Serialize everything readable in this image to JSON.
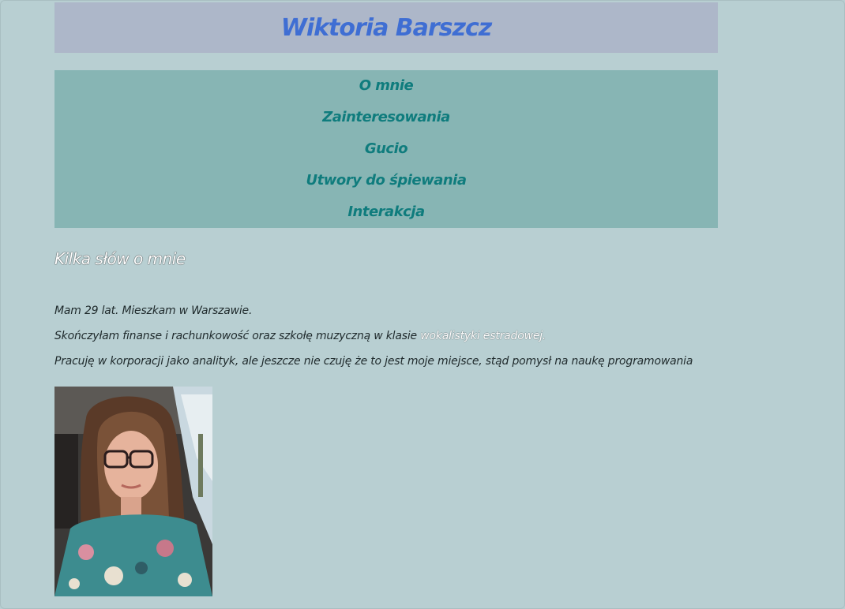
{
  "header": {
    "title": "Wiktoria Barszcz"
  },
  "nav": {
    "items": [
      {
        "label": "O mnie"
      },
      {
        "label": "Zainteresowania"
      },
      {
        "label": "Gucio"
      },
      {
        "label": "Utwory do śpiewania"
      },
      {
        "label": "Interakcja"
      }
    ]
  },
  "about": {
    "heading": "Kilka słów o mnie",
    "line1": "Mam 29 lat. Mieszkam w Warszawie.",
    "line2_start": "Skończyłam finanse i rachunkowość oraz szkołę muzyczną w klasie ",
    "line2_outlined": "wokalistyki estradowej.",
    "line3": "Pracuję w korporacji jako analityk, ale jeszcze nie czuję że to jest moje miejsce, stąd pomysł na naukę programowania"
  },
  "colors": {
    "background": "#b8cfd2",
    "header_bg": "#adb7c9",
    "title_color": "#3f6ed3",
    "nav_bg": "#87b5b4",
    "nav_link": "#0f7c7d"
  },
  "photo": {
    "icon": "portrait-photo"
  }
}
